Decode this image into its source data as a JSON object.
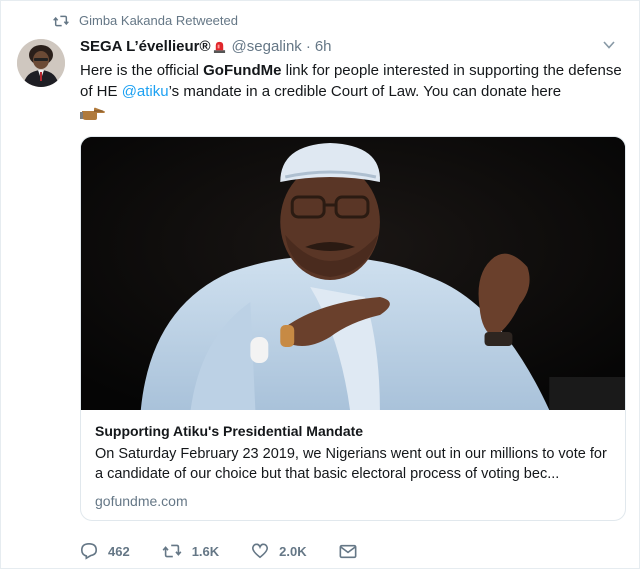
{
  "retweet_context": {
    "text": "Gimba Kakanda Retweeted"
  },
  "author": {
    "display_name": "SEGA L’évellieur®",
    "handle": "@segalink",
    "separator": "·",
    "time": "6h"
  },
  "tweet": {
    "text_part1": "Here is the official ",
    "bold_link": "GoFundMe",
    "text_part2": " link for people interested in supporting the defense of HE ",
    "mention": "@atiku",
    "text_part3": "’s mandate in a credible Court of Law. You can donate here"
  },
  "card": {
    "title": "Supporting Atiku's Presidential Mandate",
    "description": "On Saturday February 23 2019, we Nigerians went out in our millions to vote for a candidate of our choice but that basic electoral process of voting bec...",
    "domain": "gofundme.com"
  },
  "actions": {
    "replies": "462",
    "retweets": "1.6K",
    "likes": "2.0K"
  },
  "icons": {
    "retweet": "retweet-icon",
    "reply": "reply-icon",
    "like": "heart-icon",
    "dm": "envelope-icon",
    "caret": "chevron-down-icon",
    "badge": "siren-emoji-icon",
    "pointing": "pointing-hand-emoji-icon"
  },
  "colors": {
    "link": "#1da1f2",
    "secondary": "#657786",
    "text": "#14171a",
    "border": "#e1e8ed"
  }
}
